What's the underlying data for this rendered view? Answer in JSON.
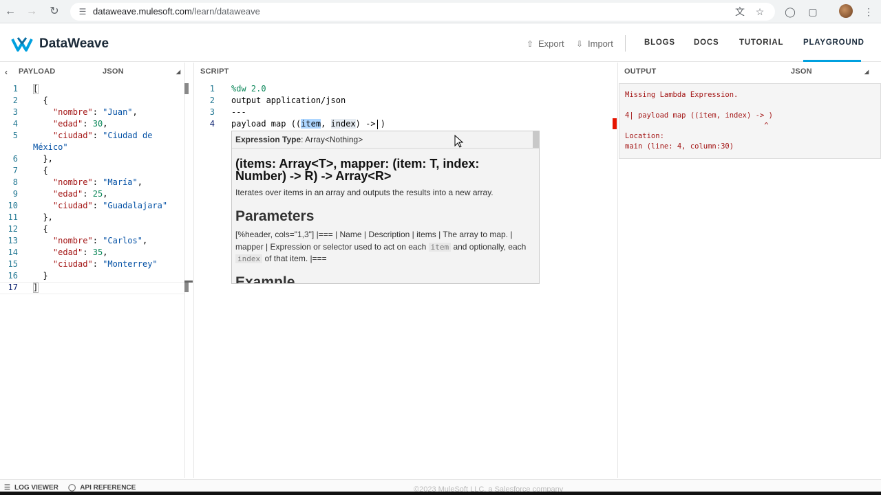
{
  "browser": {
    "url_host": "dataweave.mulesoft.com",
    "url_path": "/learn/dataweave"
  },
  "header": {
    "brand": "DataWeave",
    "export_label": "Export",
    "import_label": "Import",
    "nav": [
      "BLOGS",
      "DOCS",
      "TUTORIAL",
      "PLAYGROUND"
    ],
    "active_nav": "PLAYGROUND"
  },
  "payload": {
    "title": "PAYLOAD",
    "format": "JSON",
    "line_numbers": [
      "1",
      "2",
      "3",
      "4",
      "5",
      "",
      "6",
      "7",
      "8",
      "9",
      "10",
      "11",
      "12",
      "13",
      "14",
      "15",
      "16",
      "17"
    ],
    "lines": [
      "[",
      "  {",
      "    \"nombre\": \"Juan\",",
      "    \"edad\": 30,",
      "    \"ciudad\": \"Ciudad de",
      "México\"",
      "  },",
      "  {",
      "    \"nombre\": \"María\",",
      "    \"edad\": 25,",
      "    \"ciudad\": \"Guadalajara\"",
      "  },",
      "  {",
      "    \"nombre\": \"Carlos\",",
      "    \"edad\": 35,",
      "    \"ciudad\": \"Monterrey\"",
      "  }",
      "]"
    ]
  },
  "script": {
    "title": "SCRIPT",
    "line_numbers": [
      "1",
      "2",
      "3",
      "4"
    ],
    "line1": "%dw 2.0",
    "line2": "output application/json",
    "line3": "---",
    "line4_prefix": "payload map ((",
    "line4_item": "item",
    "line4_comma": ", ",
    "line4_index": "index",
    "line4_suffix": ") -> )"
  },
  "tooltip": {
    "type_label": "Expression Type",
    "type_value": ": Array<Nothing>",
    "signature": "(items: Array<T>, mapper: (item: T, index: Number) -> R) -> Array<R>",
    "description": "Iterates over items in an array and outputs the results into a new array.",
    "params_heading": "Parameters",
    "params_text_1": "[%header, cols=\"1,3\"] |=== | Name | Description | items | The array to map. | mapper | Expression or selector used to act on each",
    "params_code_1": "item",
    "params_text_2": "and optionally, each",
    "params_code_2": "index",
    "params_text_3": "of that item. |===",
    "example_heading": "Example"
  },
  "output": {
    "title": "OUTPUT",
    "format": "JSON",
    "lines": [
      "Missing Lambda Expression.",
      "",
      "4| payload map ((item, index) -> )",
      "                                ^",
      "Location:",
      "main (line: 4, column:30)"
    ]
  },
  "footer": {
    "log_viewer": "LOG VIEWER",
    "api_reference": "API REFERENCE",
    "copyright": "©2023 MuleSoft LLC, a Salesforce company"
  }
}
